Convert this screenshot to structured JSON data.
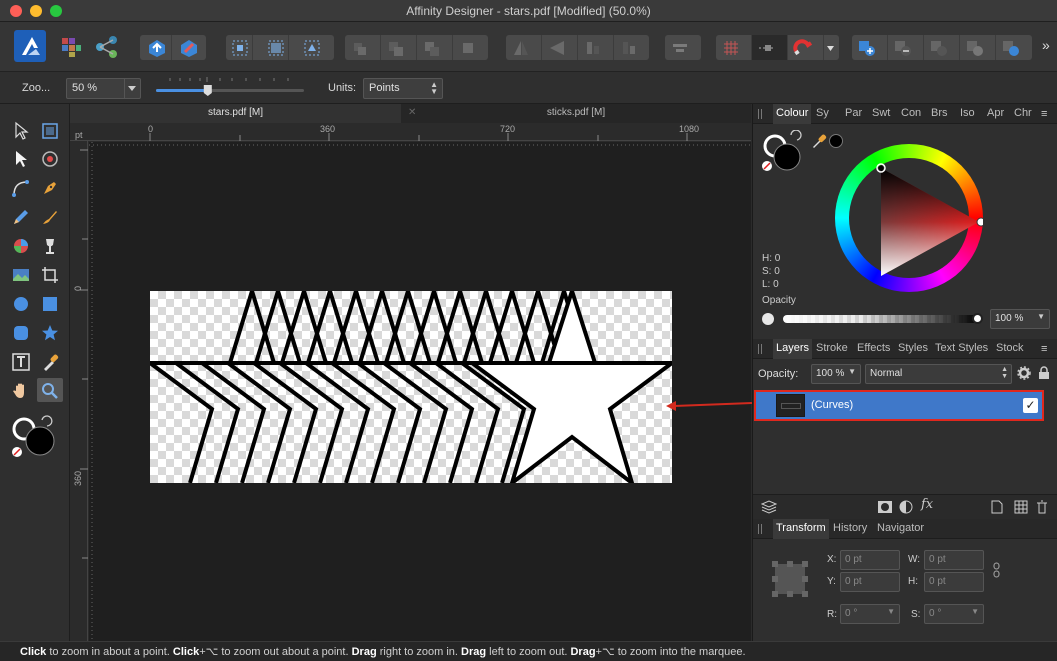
{
  "window": {
    "title": "Affinity Designer - stars.pdf [Modified] (50.0%)",
    "traffic_colors": {
      "close": "#fe5f57",
      "minimize": "#febc2e",
      "maximize": "#28c840"
    }
  },
  "toolbar": {
    "icons": [
      "designer-persona-icon",
      "pixel-persona-icon",
      "export-persona-icon",
      "share-icon",
      "pin-icon"
    ],
    "overflow_label": "»"
  },
  "context": {
    "zoom_label": "Zoo...",
    "zoom_value": "50 %",
    "zoom_slider_fraction": 0.35,
    "units_label": "Units:",
    "units_value": "Points"
  },
  "document_tabs": [
    {
      "label": "stars.pdf [M]",
      "active": true
    },
    {
      "label": "sticks.pdf [M]",
      "active": false
    }
  ],
  "ruler": {
    "unit_label": "pt",
    "top_ticks": [
      "0",
      "360",
      "720",
      "1080"
    ],
    "left_ticks": [
      "0",
      "360"
    ]
  },
  "color_panel": {
    "tabs": [
      "Colour",
      "Sy",
      "Par",
      "Swt",
      "Con",
      "Brs",
      "Iso",
      "Apr",
      "Chr"
    ],
    "hsl": {
      "h": "H: 0",
      "s": "S: 0",
      "l": "L: 0"
    },
    "opacity_label": "Opacity",
    "opacity_value": "100 %",
    "accent_red": "#e01d1d"
  },
  "layers_panel": {
    "tabs": [
      "Layers",
      "Stroke",
      "Effects",
      "Styles",
      "Text Styles",
      "Stock"
    ],
    "opacity_label": "Opacity:",
    "opacity_value": "100 %",
    "blend_mode": "Normal",
    "layer_name": "(Curves)",
    "layer_visible_check": "✓",
    "selection_color": "#3f78c9",
    "highlight_border": "#e0281e"
  },
  "transform_panel": {
    "tabs": [
      "Transform",
      "History",
      "Navigator"
    ],
    "x_label": "X:",
    "x_value": "0 pt",
    "y_label": "Y:",
    "y_value": "0 pt",
    "w_label": "W:",
    "w_value": "0 pt",
    "h_label": "H:",
    "h_value": "0 pt",
    "r_label": "R:",
    "r_value": "0 °",
    "s_label": "S:",
    "s_value": "0 °"
  },
  "status": {
    "parts": [
      {
        "bold": "Click",
        "text": " to zoom in about a point. "
      },
      {
        "bold": "Click",
        "text": "+⌥ to zoom out about a point. "
      },
      {
        "bold": "Drag",
        "text": " right to zoom in. "
      },
      {
        "bold": "Drag",
        "text": " left to zoom out. "
      },
      {
        "bold": "Drag",
        "text": "+⌥ to zoom into the marquee."
      }
    ]
  }
}
